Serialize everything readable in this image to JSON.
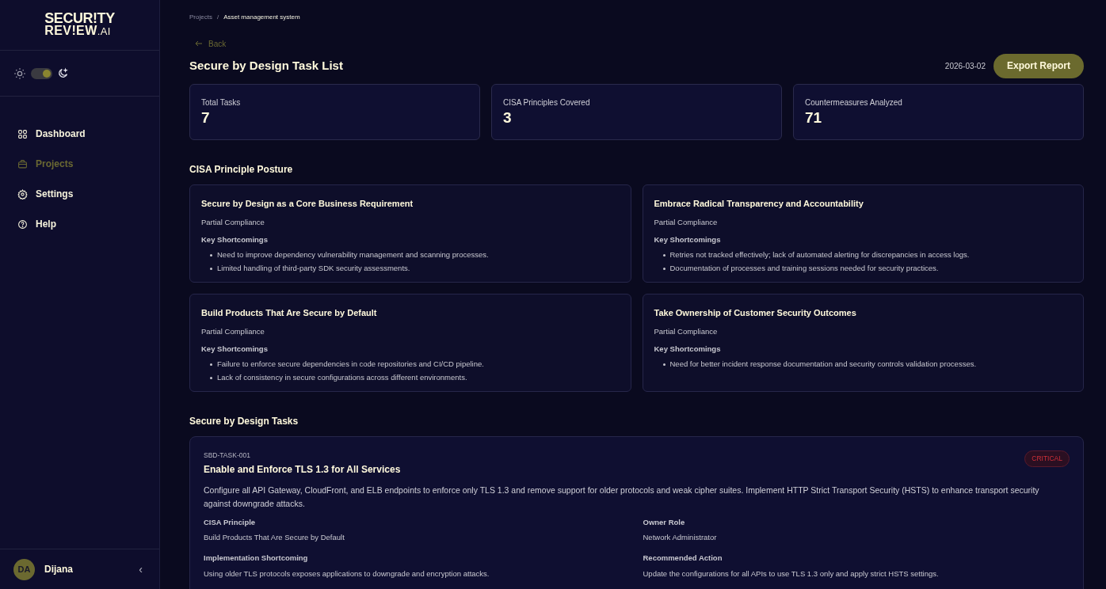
{
  "sidebar": {
    "logo": {
      "line1": "SECUR!TY",
      "line2": "REV!EW",
      "suffix": ".AI"
    },
    "theme_toggle": {
      "on": true
    },
    "items": [
      {
        "label": "Dashboard",
        "kind": "grid",
        "selected": false
      },
      {
        "label": "Projects",
        "kind": "briefcase",
        "selected": true
      },
      {
        "label": "Settings",
        "kind": "gear",
        "selected": false
      },
      {
        "label": "Help",
        "kind": "help",
        "selected": false
      }
    ],
    "user": {
      "initials": "DA",
      "name": "Dijana"
    },
    "collapse": "‹"
  },
  "breadcrumb": {
    "items": [
      "Projects",
      "Asset management system"
    ],
    "separator": "/"
  },
  "back": "Back",
  "title": "Secure by Design Task List",
  "date": "2026-03-02",
  "export_button": "Export Report",
  "stats": [
    {
      "label": "Total Tasks",
      "value": "7"
    },
    {
      "label": "CISA Principles Covered",
      "value": "3"
    },
    {
      "label": "Countermeasures Analyzed",
      "value": "71"
    }
  ],
  "posture": {
    "heading": "CISA Principle Posture",
    "cards": [
      {
        "title": "Secure by Design as a Core Business Requirement",
        "status": "Partial Compliance",
        "shortcomings_label": "Key Shortcomings",
        "items": [
          "Need to improve dependency vulnerability management and scanning processes.",
          "Limited handling of third-party SDK security assessments."
        ]
      },
      {
        "title": "Embrace Radical Transparency and Accountability",
        "status": "Partial Compliance",
        "shortcomings_label": "Key Shortcomings",
        "items": [
          "Retries not tracked effectively; lack of automated alerting for discrepancies in access logs.",
          "Documentation of processes and training sessions needed for security practices."
        ]
      },
      {
        "title": "Build Products That Are Secure by Default",
        "status": "Partial Compliance",
        "shortcomings_label": "Key Shortcomings",
        "items": [
          "Failure to enforce secure dependencies in code repositories and CI/CD pipeline.",
          "Lack of consistency in secure configurations across different environments."
        ]
      },
      {
        "title": "Take Ownership of Customer Security Outcomes",
        "status": "Partial Compliance",
        "shortcomings_label": "Key Shortcomings",
        "items": [
          "Need for better incident response documentation and security controls validation processes."
        ]
      }
    ]
  },
  "tasks": {
    "heading": "Secure by Design Tasks",
    "items": [
      {
        "id": "SBD-TASK-001",
        "title": "Enable and Enforce TLS 1.3 for All Services",
        "severity": "CRITICAL",
        "description": "Configure all API Gateway, CloudFront, and ELB endpoints to enforce only TLS 1.3 and remove support for older protocols and weak cipher suites. Implement HTTP Strict Transport Security (HSTS) to enhance transport security against downgrade attacks.",
        "fields": [
          {
            "label": "CISA Principle",
            "value": "Build Products That Are Secure by Default"
          },
          {
            "label": "Owner Role",
            "value": "Network Administrator"
          },
          {
            "label": "Implementation Shortcoming",
            "value": "Using older TLS protocols exposes applications to downgrade and encryption attacks."
          },
          {
            "label": "Recommended Action",
            "value": "Update the configurations for all APIs to use TLS 1.3 only and apply strict HSTS settings."
          }
        ]
      }
    ]
  }
}
